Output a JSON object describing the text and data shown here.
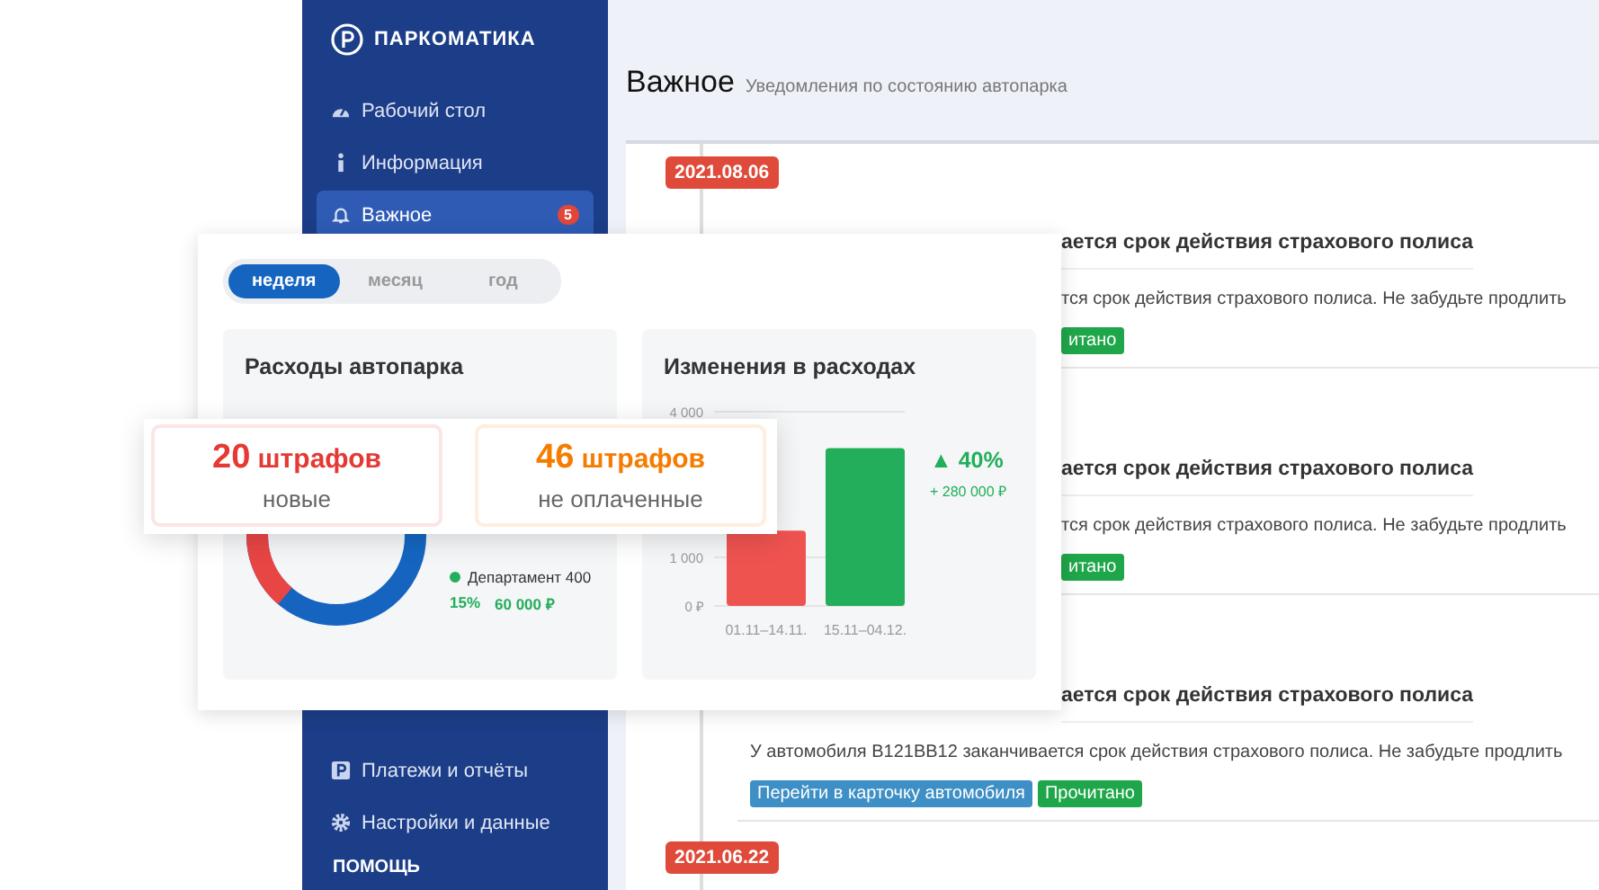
{
  "sidebar": {
    "logo": "ПАРКОМАТИКА",
    "items": [
      {
        "kind": "item",
        "label": "Рабочий стол",
        "selected": false
      },
      {
        "kind": "item",
        "label": "Информация",
        "selected": false
      },
      {
        "kind": "item",
        "label": "Важное",
        "selected": true,
        "badge": "5"
      }
    ],
    "bottom_items": [
      {
        "kind": "item",
        "label": "Платежи и отчёты",
        "selected": false
      },
      {
        "kind": "item",
        "label": "Настройки и данные",
        "selected": false
      },
      {
        "kind": "heading",
        "label": "ПОМОЩЬ"
      }
    ]
  },
  "page": {
    "title": "Важное",
    "subtitle": "Уведомления по состоянию автопарка"
  },
  "timeline": [
    {
      "date": "2021.08.06",
      "items": [
        {
          "kind": "clipped",
          "title": "ается срок действия страхового полиса",
          "body": "тся срок действия страхового полиса. Не забудьте продлить",
          "buttons": [
            {
              "kind": "read",
              "label": "итано"
            }
          ]
        },
        {
          "kind": "clipped",
          "title": "ается срок действия страхового полиса",
          "body": "тся срок действия страхового полиса. Не забудьте продлить",
          "buttons": [
            {
              "kind": "read",
              "label": "итано"
            }
          ]
        },
        {
          "kind": "open",
          "title": "ается срок действия страхового полиса",
          "body": "У автомобиля B121BB12 заканчивается срок действия страхового полиса. Не забудьте продлить",
          "buttons": [
            {
              "kind": "link",
              "label": "Перейти в карточку автомобиля"
            },
            {
              "kind": "read",
              "label": "Прочитано"
            }
          ]
        }
      ]
    },
    {
      "date": "2021.06.22"
    }
  ],
  "dashboard": {
    "periods": [
      {
        "label": "неделя",
        "selected": true
      },
      {
        "label": "месяц",
        "selected": false
      },
      {
        "label": "год",
        "selected": false
      }
    ],
    "expenses": {
      "title": "Расходы автопарка",
      "legend": [
        {
          "name": "Департамент 400",
          "color": "#22ae5a",
          "share": "15%",
          "amount": "60 000 ₽"
        }
      ]
    },
    "changes": {
      "title": "Изменения в расходах",
      "change": "▲ 40%",
      "delta": "+ 280 000 ₽",
      "chart_data": {
        "type": "bar",
        "categories": [
          "01.11–14.11.",
          "15.11–04.12."
        ],
        "series": [
          {
            "color": "#ef5350",
            "values": [
              1550,
              null
            ]
          },
          {
            "color": "#22ae5a",
            "values": [
              null,
              3250
            ]
          }
        ],
        "ylim": [
          0,
          4000
        ],
        "yticks": [
          {
            "value": 0,
            "label": "0 ₽"
          },
          {
            "value": 1000,
            "label": "1 000"
          },
          {
            "value": 4000,
            "label": "4 000"
          }
        ],
        "stacked": true
      }
    }
  },
  "fines": [
    {
      "count": "20",
      "word": "штрафов",
      "caption": "новые",
      "color": "#e53935"
    },
    {
      "count": "46",
      "word": "штрафов",
      "caption": "не оплаченные",
      "color": "#f57c00"
    }
  ]
}
